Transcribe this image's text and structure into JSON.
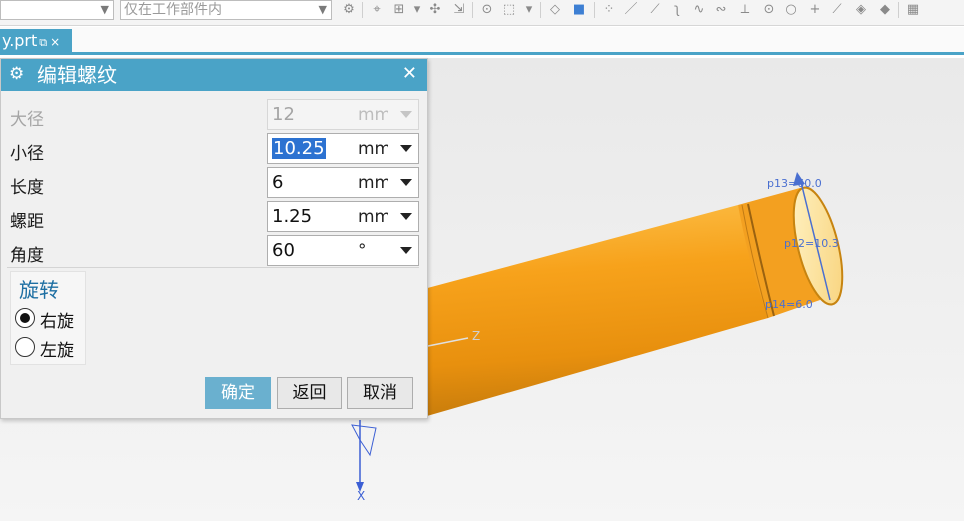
{
  "toolbar": {
    "filter_combo_value": "",
    "scope_combo_value": "仅在工作部件内"
  },
  "tab": {
    "label": "y.prt",
    "pin_icon": "pin-icon",
    "close_symbol": "×"
  },
  "dialog": {
    "title": "编辑螺纹",
    "gear_icon": "gear-icon",
    "close_symbol": "✕",
    "rows": [
      {
        "label": "大径",
        "value": "12",
        "unit": "mm",
        "disabled": true
      },
      {
        "label": "小径",
        "value": "10.25",
        "unit": "mm",
        "disabled": false,
        "selected": true
      },
      {
        "label": "长度",
        "value": "6",
        "unit": "mm",
        "disabled": false
      },
      {
        "label": "螺距",
        "value": "1.25",
        "unit": "mm",
        "disabled": false
      },
      {
        "label": "角度",
        "value": "60",
        "unit": "°",
        "disabled": false
      }
    ],
    "rotation": {
      "title": "旋转",
      "options": [
        {
          "label": "右旋",
          "checked": true
        },
        {
          "label": "左旋",
          "checked": false
        }
      ]
    },
    "buttons": {
      "ok": "确定",
      "back": "返回",
      "cancel": "取消"
    }
  },
  "viewport": {
    "labels": {
      "p13": "p13=60.0",
      "p12": "p12=10.3",
      "p14": "p14=6.0",
      "z_axis": "Z",
      "x_axis": "X"
    },
    "colors": {
      "cylinder": "#f7a21b",
      "cylinder_dark": "#c77c0c",
      "accent": "#4aa3c7",
      "annotation": "#4a6fd0"
    }
  }
}
